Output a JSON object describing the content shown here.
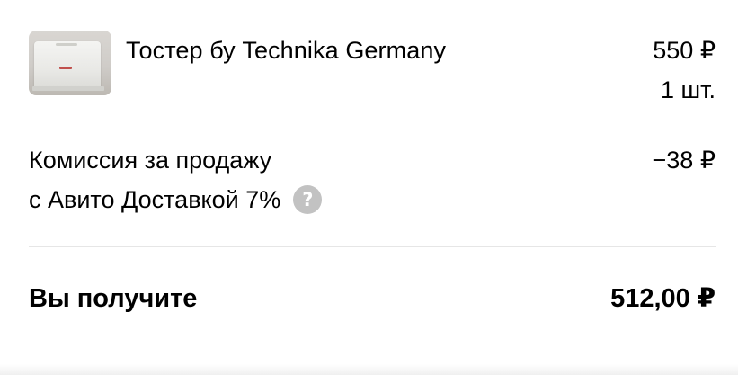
{
  "product": {
    "title": "Тостер бу Technika Germany",
    "price": "550 ₽",
    "quantity": "1 шт.",
    "image_icon": "toaster-photo"
  },
  "commission": {
    "label_line1": "Комиссия за продажу",
    "label_line2": "с Авито Доставкой 7%",
    "help_glyph": "?",
    "amount": "−38 ₽"
  },
  "total": {
    "label": "Вы получите",
    "amount": "512,00 ₽"
  },
  "colors": {
    "text": "#000000",
    "help_icon_bg": "#c2c2c2",
    "divider": "#e6e6e6"
  }
}
